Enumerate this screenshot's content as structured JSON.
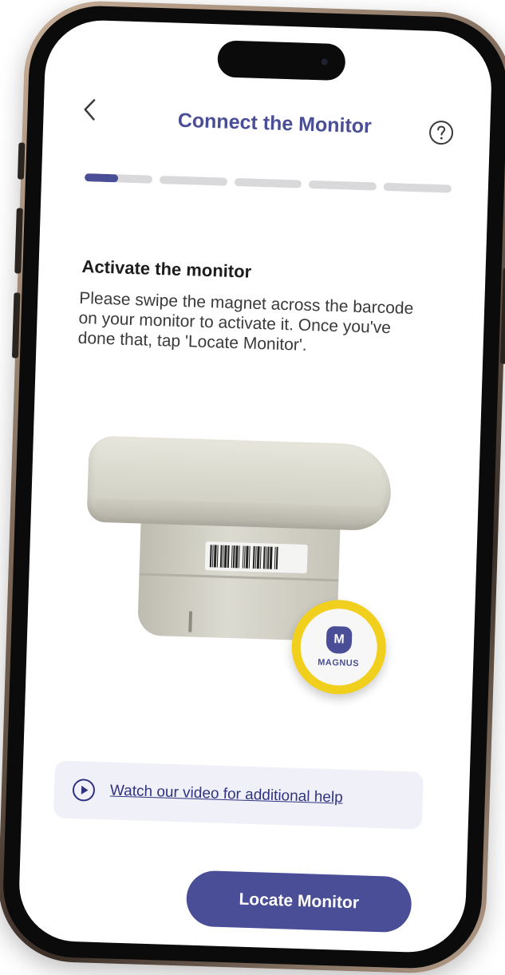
{
  "header": {
    "title": "Connect the Monitor",
    "back_icon": "chevron-left-icon",
    "help_icon": "question-circle-icon"
  },
  "progress": {
    "total_steps": 5,
    "current_step": 1,
    "current_step_fill": 0.5
  },
  "content": {
    "heading": "Activate the monitor",
    "instructions": "Please swipe the magnet across the barcode on your monitor to activate it. Once you've done that, tap 'Locate Monitor'."
  },
  "illustration": {
    "magnet_logo_letter": "M",
    "magnet_brand": "MAGNUS"
  },
  "video_help": {
    "icon": "play-circle-icon",
    "label": "Watch our video for additional help"
  },
  "cta": {
    "label": "Locate Monitor"
  },
  "colors": {
    "primary": "#4a4e96",
    "progress_inactive": "#d9d9dc",
    "magnet_ring": "#f1cf1d",
    "help_panel": "#f0f1f8"
  }
}
